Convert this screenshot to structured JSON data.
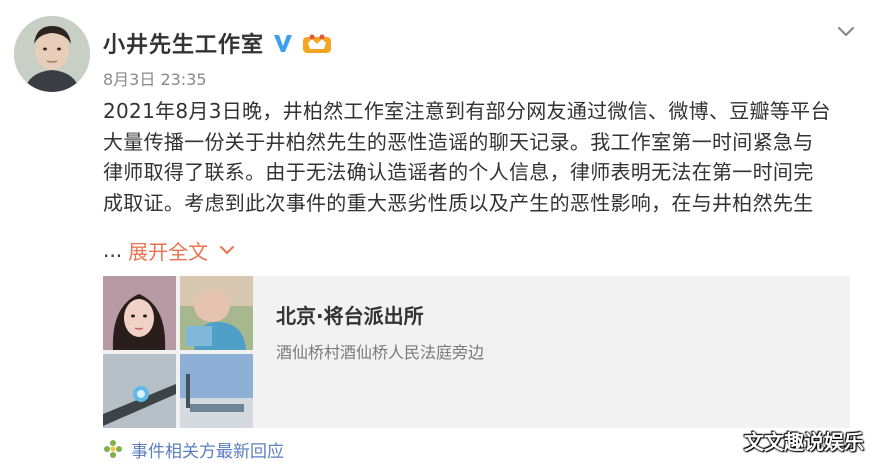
{
  "post": {
    "author": "小井先生工作室",
    "timestamp": "8月3日 23:35",
    "text_lines": [
      "2021年8月3日晚，井柏然工作室注意到有部分网友通过微信、微博、豆瓣等平台",
      "大量传播一份关于井柏然先生的恶性造谣的聊天记录。我工作室第一时间紧急与",
      "律师取得了联系。由于无法确认造谣者的个人信息，律师表明无法在第一时间完",
      "成取证。考虑到此次事件的重大恶劣性质以及产生的恶性影响，在与井柏然先生"
    ],
    "ellipsis": "...",
    "expand_label": "展开全文"
  },
  "location": {
    "name": "北京·将台派出所",
    "address": "酒仙桥村酒仙桥人民法庭旁边"
  },
  "related": {
    "label": "事件相关方最新回应"
  },
  "watermark": "文文趣说娱乐",
  "icons": {
    "verified": "verified-v-icon",
    "member": "member-crown-icon",
    "menu": "chevron-down-icon",
    "expand": "chevron-down-icon",
    "related": "flower-icon"
  },
  "colors": {
    "accent_orange": "#eb7350",
    "link_blue": "#5b7fbf",
    "verified_blue": "#3e9ff0",
    "card_bg": "#f2f2f2"
  }
}
